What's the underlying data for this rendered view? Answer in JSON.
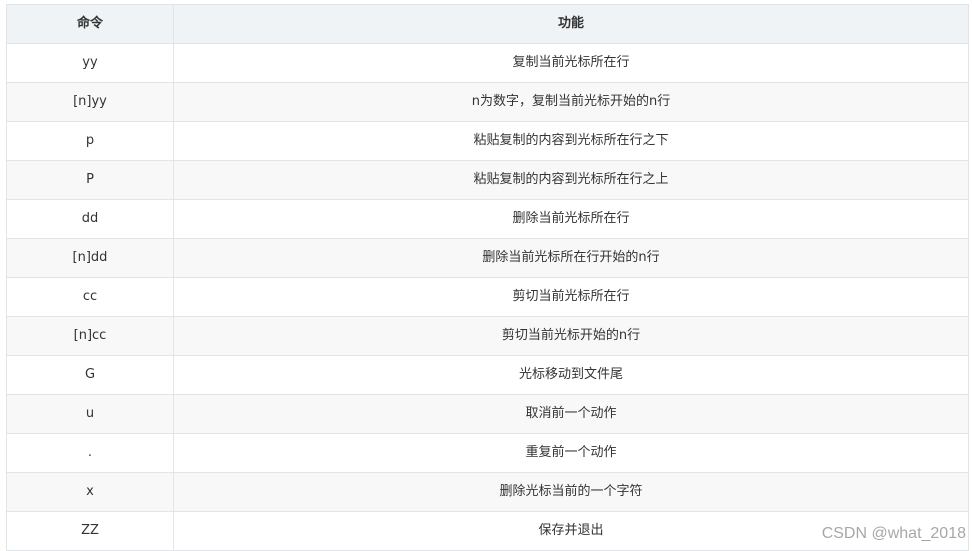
{
  "table": {
    "headers": [
      "命令",
      "功能"
    ],
    "rows": [
      [
        "yy",
        "复制当前光标所在行"
      ],
      [
        "[n]yy",
        "n为数字，复制当前光标开始的n行"
      ],
      [
        "p",
        "粘贴复制的内容到光标所在行之下"
      ],
      [
        "P",
        "粘贴复制的内容到光标所在行之上"
      ],
      [
        "dd",
        "删除当前光标所在行"
      ],
      [
        "[n]dd",
        "删除当前光标所在行开始的n行"
      ],
      [
        "cc",
        "剪切当前光标所在行"
      ],
      [
        "[n]cc",
        "剪切当前光标开始的n行"
      ],
      [
        "G",
        "光标移动到文件尾"
      ],
      [
        "u",
        "取消前一个动作"
      ],
      [
        ".",
        "重复前一个动作"
      ],
      [
        "x",
        "删除光标当前的一个字符"
      ],
      [
        "ZZ",
        "保存并退出"
      ]
    ]
  },
  "watermark": "CSDN @what_2018"
}
